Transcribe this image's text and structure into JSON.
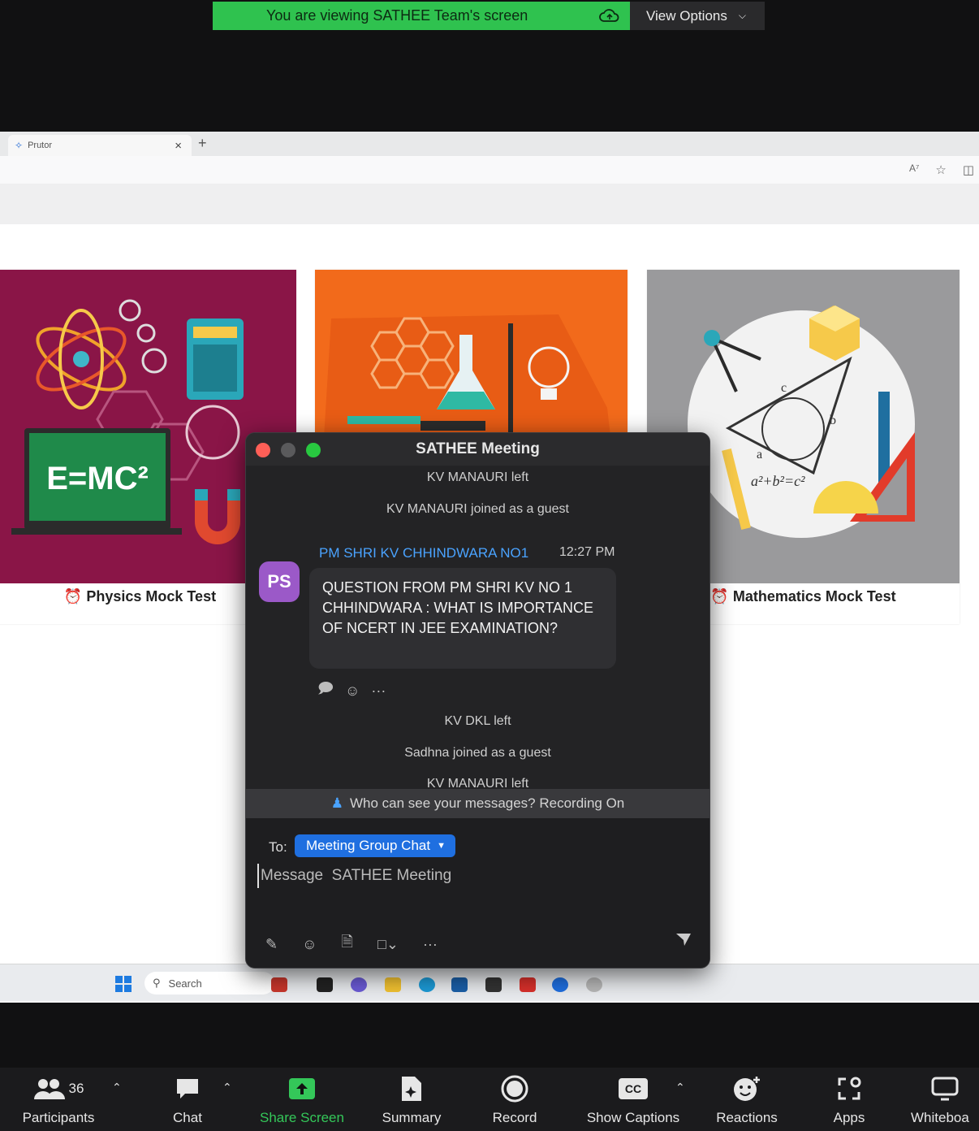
{
  "banner": {
    "text": "You are viewing SATHEE Team's screen",
    "view_options": "View Options"
  },
  "browser": {
    "tab_title": "Prutor",
    "tab_close": "×",
    "new_tab": "+"
  },
  "cards": [
    {
      "art_text": "E=MC²",
      "title": "Physics Mock Test"
    },
    {
      "title": ""
    },
    {
      "art_text": "a²+b²=c²",
      "title": "Mathematics Mock Test"
    }
  ],
  "taskbar": {
    "search_label": "Search"
  },
  "chat": {
    "title": "SATHEE Meeting",
    "events_top": [
      "KV MANAURI left",
      "KV MANAURI joined as a guest"
    ],
    "message": {
      "avatar": "PS",
      "sender": "PM SHRI KV CHHINDWARA NO1",
      "time": "12:27 PM",
      "text": "QUESTION FROM PM SHRI KV NO 1 CHHINDWARA : WHAT IS IMPORTANCE OF NCERT IN JEE EXAMINATION?",
      "more": "···"
    },
    "events_bottom": [
      "KV DKL left",
      "Sadhna joined as a guest",
      "KV MANAURI left"
    ],
    "notice": "Who can see your messages? Recording On",
    "to_label": "To:",
    "recipient": "Meeting Group Chat",
    "input_placeholder": "Message  SATHEE Meeting",
    "more": "···"
  },
  "toolbar": {
    "participants_count": "36",
    "items": [
      "Participants",
      "Chat",
      "Share Screen",
      "Summary",
      "Record",
      "Show Captions",
      "Reactions",
      "Apps",
      "Whiteboa"
    ]
  },
  "colors": {
    "share_green": "#2fc24f",
    "accent_blue": "#1f6fe0",
    "sender_blue": "#4aa3ff",
    "avatar_purple": "#9b59c8"
  }
}
